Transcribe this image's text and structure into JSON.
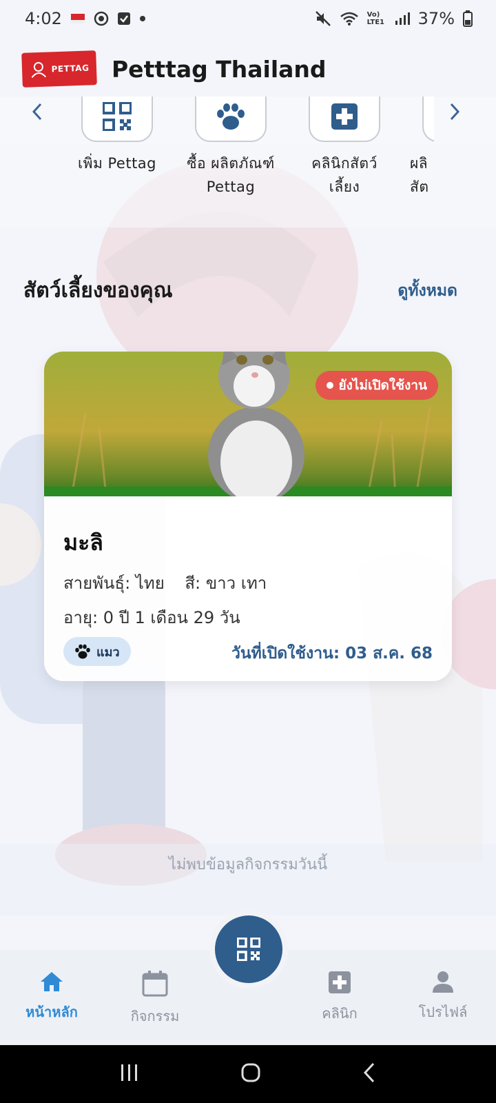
{
  "status_bar": {
    "time": "4:02",
    "network": "Vo) LTE1",
    "battery": "37%"
  },
  "header": {
    "logo_text": "PETTAG",
    "title": "Petttag Thailand"
  },
  "shortcuts": [
    {
      "label": "เพิ่ม Pettag",
      "icon": "qr-code-icon"
    },
    {
      "label": "ซื้อ ผลิตภัณฑ์ Pettag",
      "icon": "paw-icon"
    },
    {
      "label": "คลินิกสัตว์ เลี้ยง",
      "icon": "medical-cross-icon"
    },
    {
      "label": "ผลิ สัต",
      "icon": "partial-icon"
    }
  ],
  "pets_section": {
    "title": "สัตว์เลี้ยงของคุณ",
    "view_all": "ดูทั้งหมด"
  },
  "pet_card": {
    "status": "ยังไม่เปิดใช้งาน",
    "name": "มะลิ",
    "breed_label": "สายพันธุ์:",
    "breed_value": "ไทย",
    "color_label": "สี:",
    "color_value": "ขาว เทา",
    "age_label": "อายุ:",
    "age_value": "0 ปี 1 เดือน 29 วัน",
    "species": "แมว",
    "activation_label": "วันที่เปิดใช้งาน:",
    "activation_date": "03 ส.ค. 68"
  },
  "activity_empty": "ไม่พบข้อมูลกิจกรรมวันนี้",
  "bottom_nav": {
    "home": "หน้าหลัก",
    "activity": "กิจกรรม",
    "clinic": "คลินิก",
    "profile": "โปรไฟล์"
  },
  "colors": {
    "primary": "#2f5d8c",
    "active_nav": "#2f8bd6",
    "status_inactive": "#e5544d",
    "logo_red": "#d7272c"
  }
}
